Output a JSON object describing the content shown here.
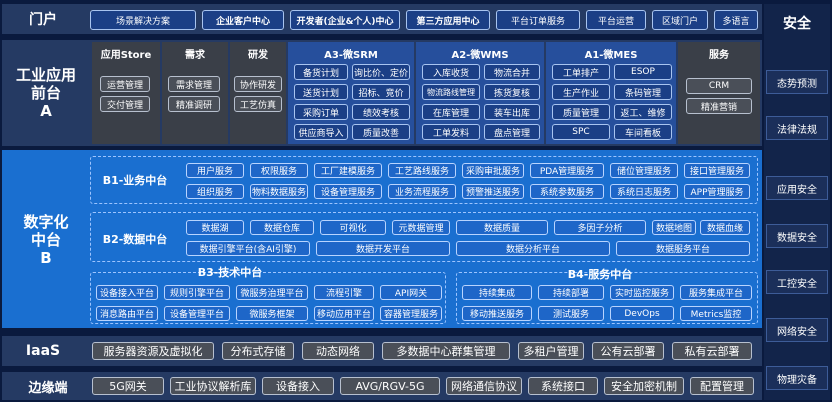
{
  "portal": {
    "label": "门户",
    "items": [
      "场景解决方案",
      "企业客户中心",
      "开发者(企业&个人)中心",
      "第三方应用中心",
      "平台订单服务",
      "平台运营",
      "区域门户",
      "多语言"
    ]
  },
  "industrial": {
    "label": "工业应用\n前台\nA",
    "sections": {
      "store": {
        "title": "应用Store",
        "items": [
          "运营管理",
          "交付管理"
        ]
      },
      "demand": {
        "title": "需求",
        "items": [
          "需求管理",
          "精准调研"
        ]
      },
      "rd": {
        "title": "研发",
        "items": [
          "协作研发",
          "工艺仿真"
        ]
      },
      "srm": {
        "title": "A3-微SRM",
        "items": [
          "备货计划",
          "询比价、定价",
          "送货计划",
          "招标、竞价",
          "采购订单",
          "绩效考核",
          "供应商导入",
          "质量改善"
        ]
      },
      "wms": {
        "title": "A2-微WMS",
        "items": [
          "入库收货",
          "物流合并",
          "物流路线管理",
          "拣货复核",
          "在库管理",
          "装车出库",
          "工单发料",
          "盘点管理"
        ]
      },
      "mes": {
        "title": "A1-微MES",
        "items": [
          "工单排产",
          "ESOP",
          "生产作业",
          "条码管理",
          "质量管理",
          "返工、维修",
          "SPC",
          "车间看板"
        ]
      },
      "service": {
        "title": "服务",
        "items": [
          "CRM",
          "精准营销"
        ]
      }
    }
  },
  "digital": {
    "label": "数字化\n中台\nB",
    "b1": {
      "title": "B1-业务中台",
      "items": [
        "用户服务",
        "权限服务",
        "工厂建模服务",
        "工艺路线服务",
        "采购审批服务",
        "PDA管理服务",
        "储位管理服务",
        "接口管理服务",
        "组织服务",
        "物料数据服务",
        "设备管理服务",
        "业务流程服务",
        "预警推送服务",
        "系统参数服务",
        "系统日志服务",
        "APP管理服务"
      ]
    },
    "b2": {
      "title": "B2-数据中台",
      "items": [
        "数据湖",
        "数据仓库",
        "可视化",
        "元数据管理",
        "数据质量",
        "多因子分析",
        "数据地图",
        "数据血缘",
        "数据引擎平台(含AI引擎)",
        "数据开发平台",
        "数据分析平台",
        "数据服务平台"
      ]
    },
    "b3": {
      "title": "B3-技术中台",
      "items": [
        "设备接入平台",
        "规则引擎平台",
        "微服务治理平台",
        "流程引擎",
        "API网关",
        "消息路由平台",
        "设备管理平台",
        "微服务框架",
        "移动应用平台",
        "容器管理服务"
      ]
    },
    "b4": {
      "title": "B4-服务中台",
      "items": [
        "持续集成",
        "持续部署",
        "实时监控服务",
        "服务集成平台",
        "移动推送服务",
        "测试服务",
        "DevOps",
        "Metrics监控"
      ]
    }
  },
  "iaas": {
    "label": "IaaS",
    "items": [
      "服务器资源及虚拟化",
      "分布式存储",
      "动态网络",
      "多数据中心群集管理",
      "多租户管理",
      "公有云部署",
      "私有云部署"
    ]
  },
  "edge": {
    "label": "边缘端",
    "items": [
      "5G网关",
      "工业协议解析库",
      "设备接入",
      "AVG/RGV-5G",
      "网络通信协议",
      "系统接口",
      "安全加密机制",
      "配置管理"
    ]
  },
  "security": {
    "title": "安全",
    "items": [
      "态势预测",
      "法律法规",
      "应用安全",
      "数据安全",
      "工控安全",
      "网络安全",
      "物理灾备"
    ]
  }
}
